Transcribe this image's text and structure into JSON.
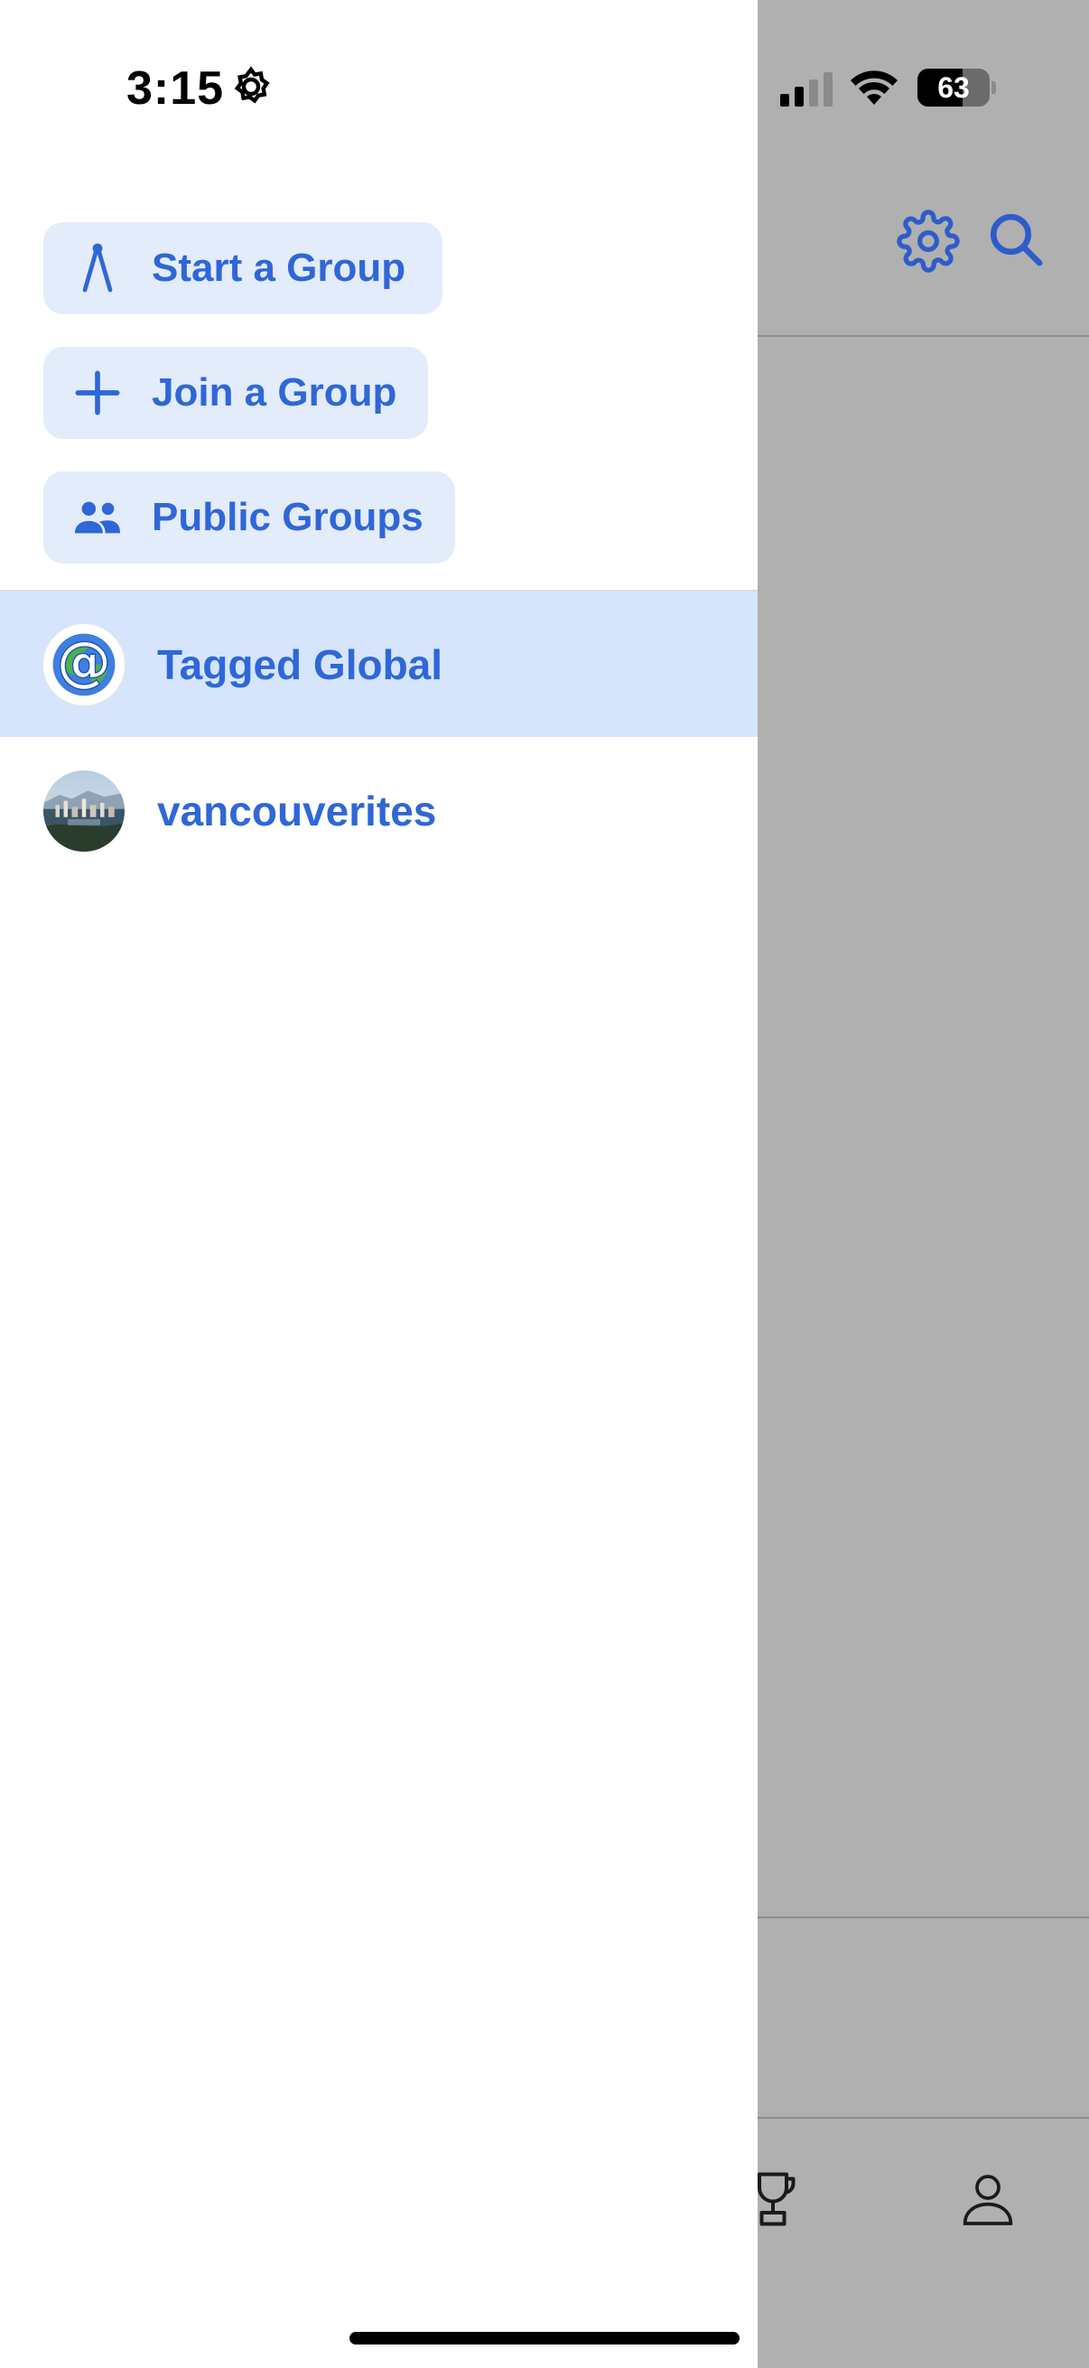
{
  "status_bar": {
    "time": "3:15",
    "battery": "63",
    "icons": [
      "gear-icon",
      "signal-icon",
      "wifi-icon",
      "battery-icon"
    ]
  },
  "drawer": {
    "actions": [
      {
        "label": "Start a Group",
        "icon": "compass-icon"
      },
      {
        "label": "Join a Group",
        "icon": "plus-icon"
      },
      {
        "label": "Public Groups",
        "icon": "people-icon"
      }
    ],
    "groups": [
      {
        "name": "Tagged Global",
        "selected": true,
        "avatar": "at-globe-logo"
      },
      {
        "name": "vancouverites",
        "selected": false,
        "avatar": "city-photo"
      }
    ]
  },
  "background_screen": {
    "header_icons": [
      "settings-gear-icon",
      "search-icon"
    ],
    "tab_icons": [
      "trophy-icon",
      "profile-icon"
    ]
  },
  "colors": {
    "accent": "#2f67d8",
    "pill_bg": "#e3ecfb",
    "selected_bg": "#d6e5fb",
    "dim_overlay": "#b0b0b0"
  }
}
